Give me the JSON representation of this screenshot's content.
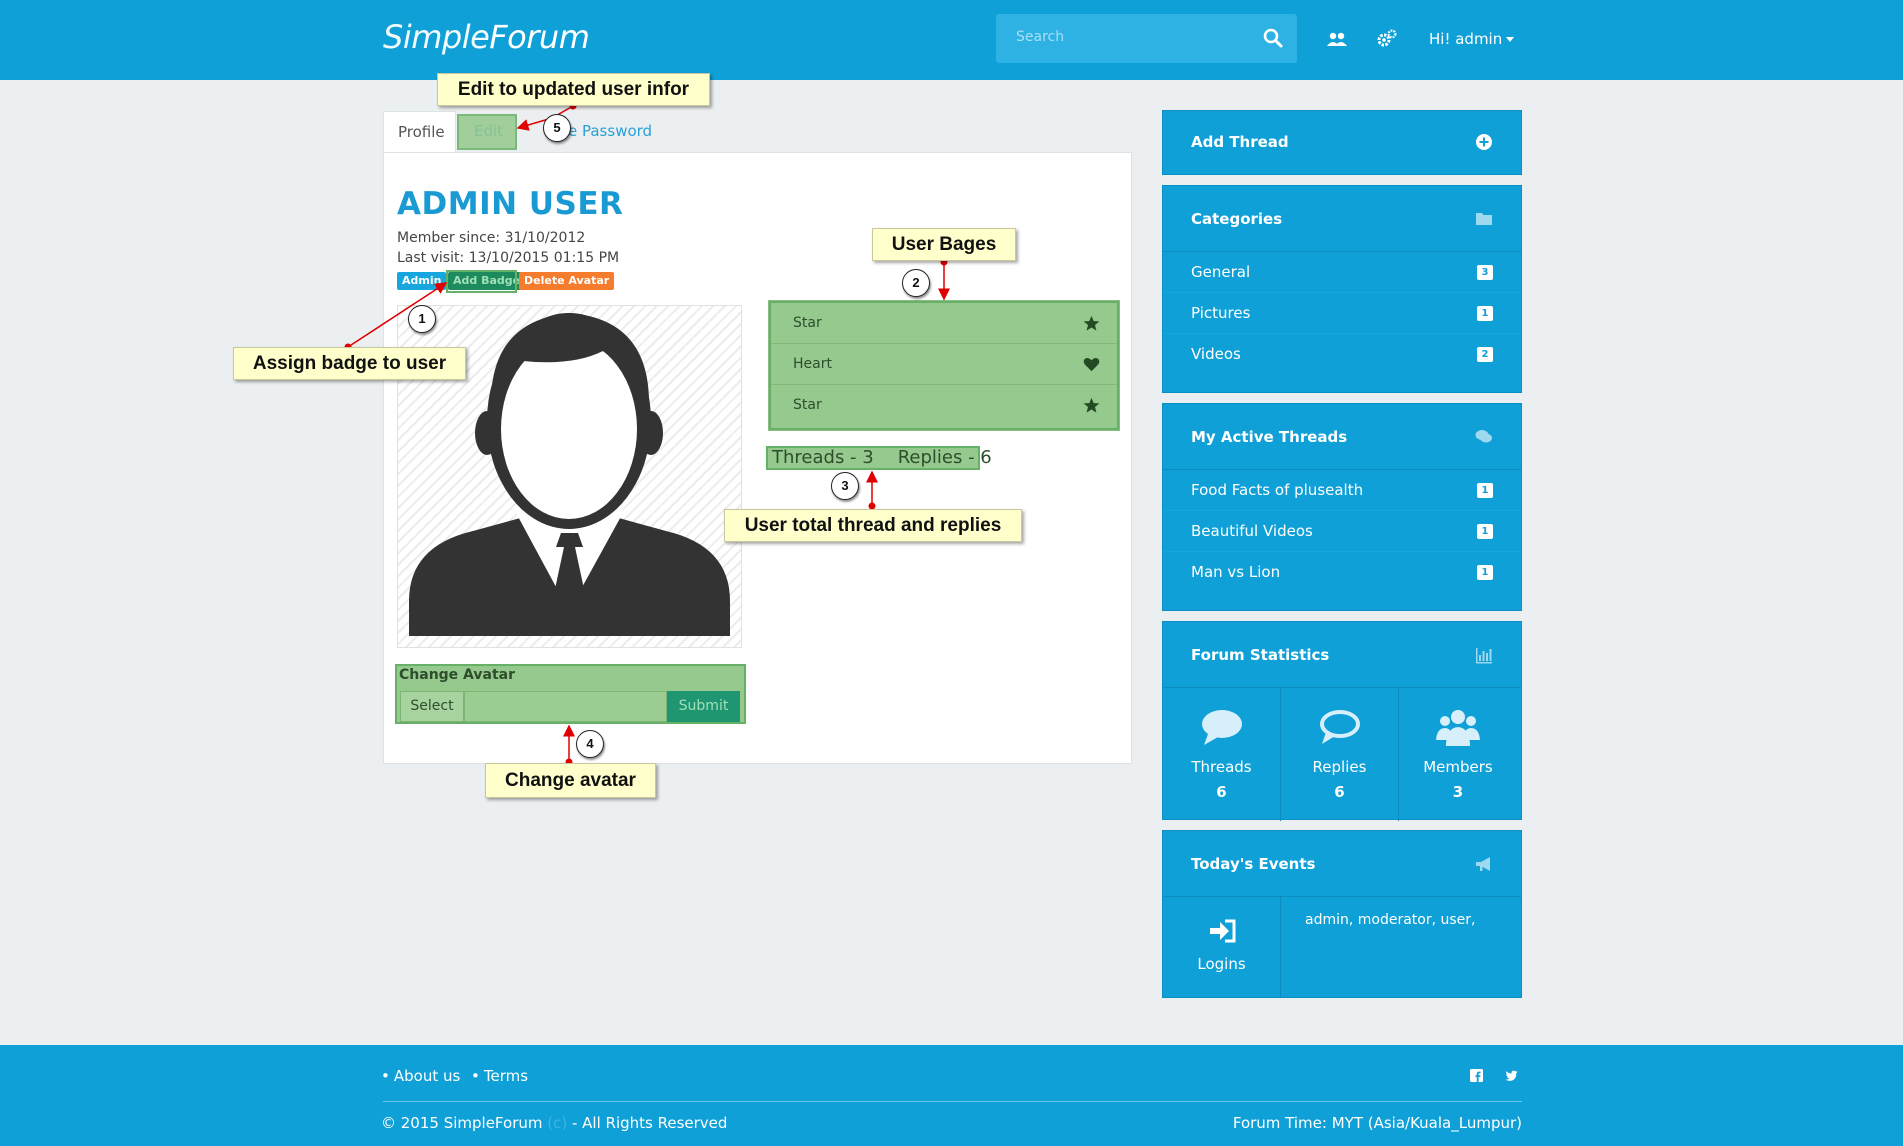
{
  "header": {
    "brand_light": "Simple",
    "brand_bold": "Forum",
    "search_placeholder": "Search",
    "user_greeting": "Hi! admin",
    "icons": [
      "search-icon",
      "users-icon",
      "gears-icon"
    ]
  },
  "profile": {
    "tabs": {
      "profile": "Profile",
      "edit": "Edit",
      "change_password": "Change Password",
      "change_password_visible": "e Password"
    },
    "name": "ADMIN USER",
    "member_since": "Member since: 31/10/2012",
    "last_visit": "Last visit: 13/10/2015 01:15 PM",
    "labels": {
      "admin": "Admin",
      "add_badge": "Add Badge",
      "delete_avatar": "Delete Avatar"
    },
    "badges": [
      {
        "name": "Star",
        "icon": "star-icon"
      },
      {
        "name": "Heart",
        "icon": "heart-icon"
      },
      {
        "name": "Star",
        "icon": "star-icon"
      }
    ],
    "threads_text": "Threads - 3",
    "replies_text": "Replies - 6",
    "change_avatar": {
      "title": "Change Avatar",
      "select": "Select",
      "submit": "Submit"
    }
  },
  "callouts": {
    "edit": "Edit to updated user infor",
    "badges": "User Bages",
    "assign": "Assign badge to user",
    "totals": "User total thread and replies",
    "avatar": "Change avatar",
    "markers": [
      "1",
      "2",
      "3",
      "4",
      "5"
    ]
  },
  "sidebar": {
    "add_thread": "Add Thread",
    "categories": {
      "title": "Categories",
      "items": [
        {
          "label": "General",
          "count": "3"
        },
        {
          "label": "Pictures",
          "count": "1"
        },
        {
          "label": "Videos",
          "count": "2"
        }
      ]
    },
    "active_threads": {
      "title": "My Active Threads",
      "items": [
        {
          "label": "Food Facts of plusealth",
          "count": "1"
        },
        {
          "label": "Beautiful Videos",
          "count": "1"
        },
        {
          "label": "Man vs Lion",
          "count": "1"
        }
      ]
    },
    "statistics": {
      "title": "Forum Statistics",
      "items": [
        {
          "label": "Threads",
          "value": "6"
        },
        {
          "label": "Replies",
          "value": "6"
        },
        {
          "label": "Members",
          "value": "3"
        }
      ]
    },
    "events": {
      "title": "Today's Events",
      "logins_label": "Logins",
      "users": "admin, moderator, user,"
    }
  },
  "footer": {
    "about": "About us",
    "terms": "Terms",
    "copyright_brand": "© 2015 SimpleForum",
    "copyright_faint": "(c)",
    "copyright_rest": " - All Rights Reserved",
    "forum_time": "Forum Time: MYT (Asia/Kuala_Lumpur)"
  },
  "colors": {
    "primary": "#0fa0d8",
    "highlight_green": "#96c98d",
    "callout_yellow": "#ffffcc",
    "annotation_red": "#e00000"
  }
}
